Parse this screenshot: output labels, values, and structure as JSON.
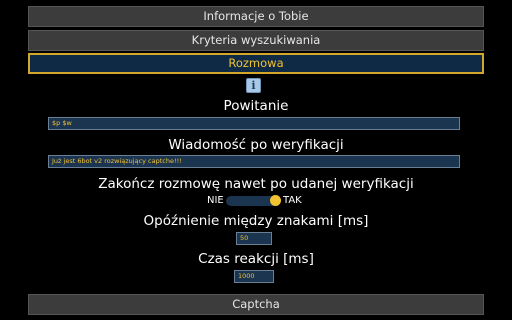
{
  "sections": {
    "about": "Informacje o Tobie",
    "criteria": "Kryteria wyszukiwania",
    "conversation": "Rozmowa",
    "captcha": "Captcha"
  },
  "info_icon": {
    "glyph": "i",
    "name": "info-icon"
  },
  "fields": {
    "greeting_label": "Powitanie",
    "greeting_value": "$p $w",
    "verify_msg_label": "Wiadomość po weryfikacji",
    "verify_msg_value": "Już jest 6bot v2 rozwiązujący captche!!!",
    "end_conv_label": "Zakończ rozmowę nawet po udanej weryfikacji",
    "toggle_no": "NIE",
    "toggle_yes": "TAK",
    "toggle_on": true,
    "delay_label": "Opóźnienie między znakami [ms]",
    "delay_value": "50",
    "reaction_label": "Czas reakcji [ms]",
    "reaction_value": "1000"
  },
  "colors": {
    "accent": "#f1c232",
    "input_bg": "#1b3450",
    "section_bg": "#3c3c3c"
  }
}
